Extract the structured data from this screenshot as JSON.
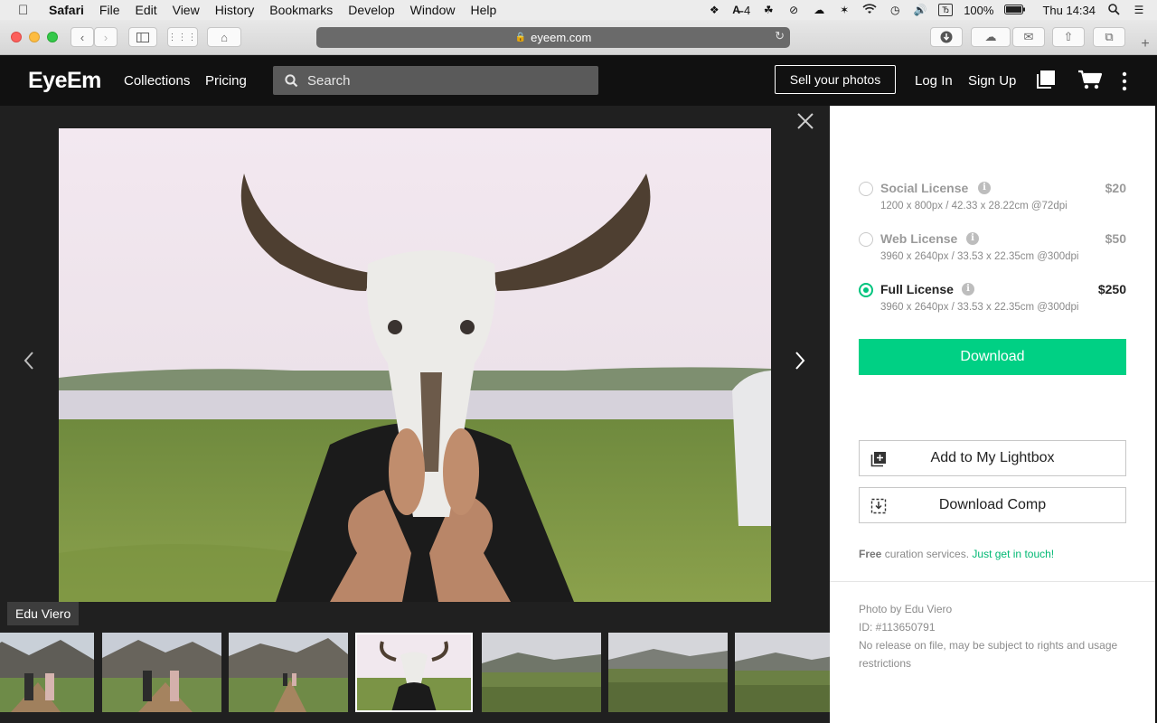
{
  "menubar": {
    "app": "Safari",
    "items": [
      "File",
      "Edit",
      "View",
      "History",
      "Bookmarks",
      "Develop",
      "Window",
      "Help"
    ],
    "battery": "100%",
    "clock": "Thu 14:34",
    "adobe_badge": "4"
  },
  "browser": {
    "url": "eyeem.com"
  },
  "header": {
    "logo": "EyeEm",
    "nav": [
      "Collections",
      "Pricing"
    ],
    "search_placeholder": "Search",
    "sell_label": "Sell your photos",
    "login_label": "Log In",
    "signup_label": "Sign Up"
  },
  "viewer": {
    "photographer_tag": "Edu Viero",
    "thumbnail_count": 7,
    "active_thumbnail_index": 3
  },
  "licenses": [
    {
      "name": "Social License",
      "dims": "1200 x 800px / 42.33 x 28.22cm @72dpi",
      "price": "$20",
      "selected": false
    },
    {
      "name": "Web License",
      "dims": "3960 x 2640px / 33.53 x 22.35cm @300dpi",
      "price": "$50",
      "selected": false
    },
    {
      "name": "Full License",
      "dims": "3960 x 2640px / 33.53 x 22.35cm @300dpi",
      "price": "$250",
      "selected": true
    }
  ],
  "actions": {
    "download_label": "Download",
    "lightbox_label": "Add to My Lightbox",
    "comp_label": "Download Comp"
  },
  "curation": {
    "free": "Free",
    "text": " curation services. ",
    "link": "Just get in touch!"
  },
  "photo_meta": {
    "credit": "Photo by Edu Viero",
    "id": "ID: #113650791",
    "release": "No release on file, may be subject to rights and usage restrictions"
  },
  "colors": {
    "accent": "#00d084",
    "header_bg": "#111111",
    "viewer_bg": "#202020"
  }
}
